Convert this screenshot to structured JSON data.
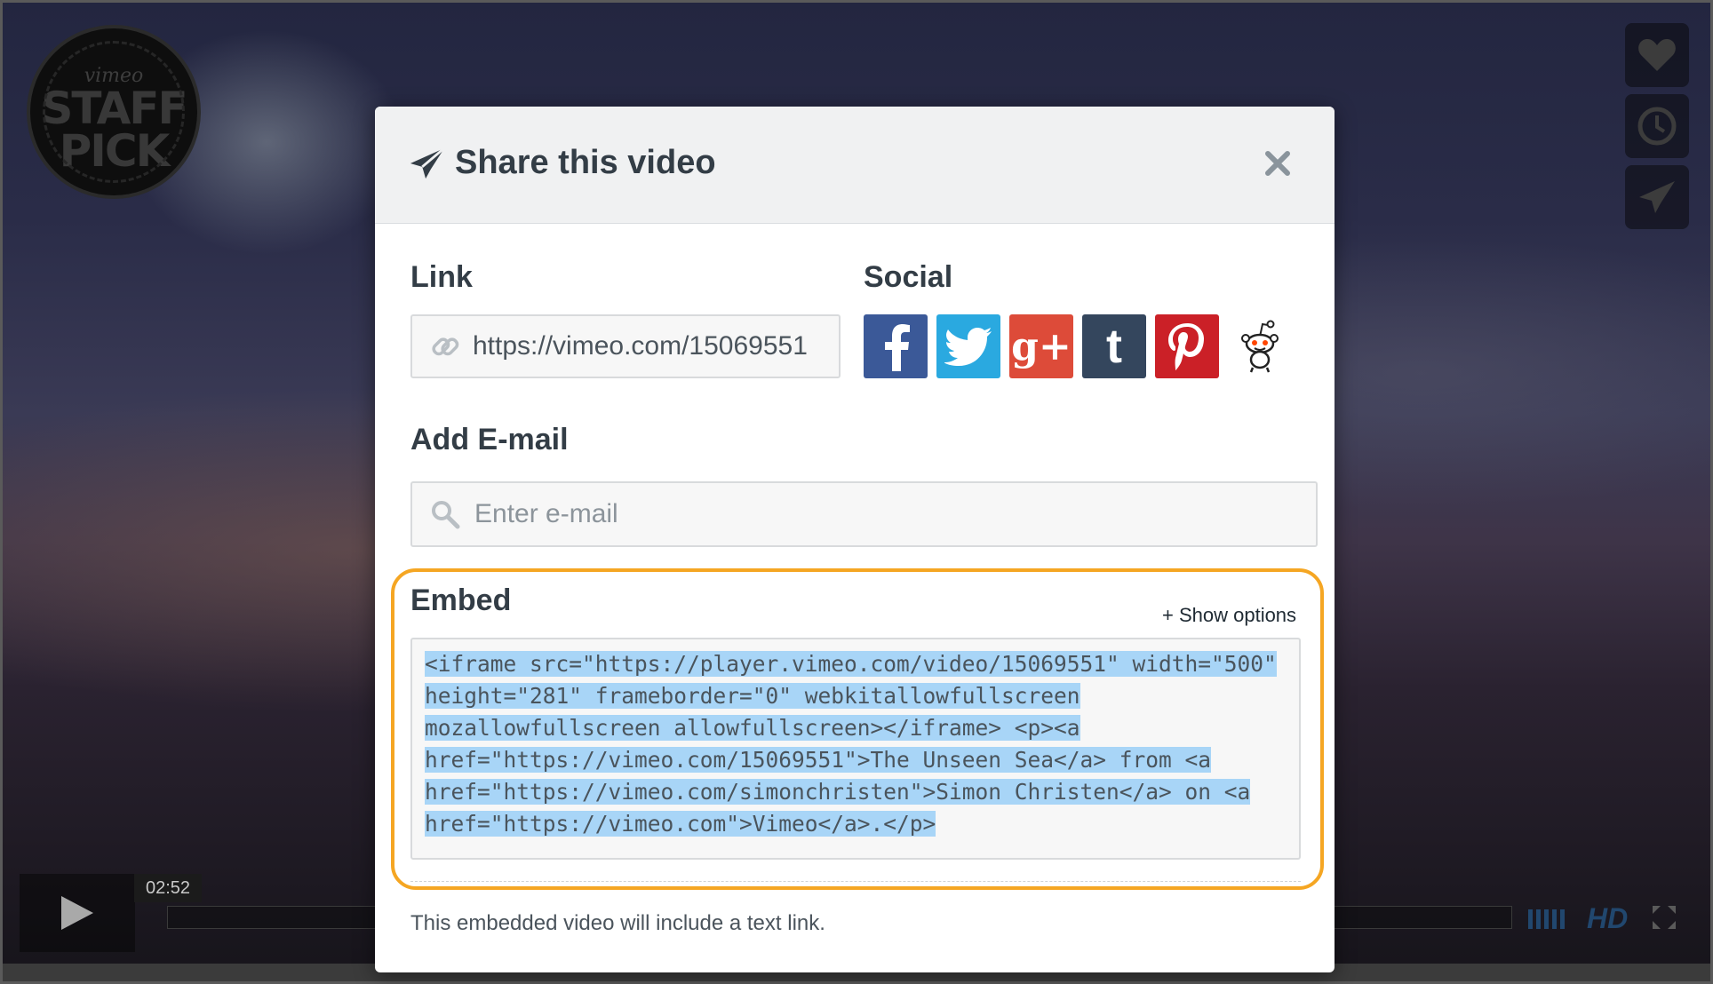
{
  "player": {
    "badge": {
      "line1": "vimeo",
      "line2": "STAFF",
      "line3": "PICK"
    },
    "side_buttons": [
      "heart-icon",
      "clock-icon",
      "send-icon"
    ],
    "time": "02:52",
    "hd_label": "HD"
  },
  "modal": {
    "title": "Share this video",
    "link": {
      "label": "Link",
      "value": "https://vimeo.com/15069551"
    },
    "social": {
      "label": "Social",
      "items": [
        {
          "name": "facebook",
          "glyph": "f",
          "color": "#3b5998"
        },
        {
          "name": "twitter",
          "glyph": "t",
          "color": "#2aa9e0"
        },
        {
          "name": "googleplus",
          "glyph": "g+",
          "color": "#dd4b39"
        },
        {
          "name": "tumblr",
          "glyph": "t",
          "color": "#34465d"
        },
        {
          "name": "pinterest",
          "glyph": "P",
          "color": "#cb2027"
        },
        {
          "name": "reddit",
          "glyph": "reddit",
          "color": "#ffffff"
        }
      ]
    },
    "email": {
      "label": "Add E-mail",
      "placeholder": "Enter e-mail"
    },
    "embed": {
      "label": "Embed",
      "show_options": "+ Show options",
      "code_lines": [
        "<iframe src=\"https://player.vimeo.com/video/15069551\" width=\"500\"",
        "height=\"281\" frameborder=\"0\" webkitallowfullscreen",
        "mozallowfullscreen allowfullscreen></iframe> <p><a",
        "href=\"https://vimeo.com/15069551\">The Unseen Sea</a> from <a",
        "href=\"https://vimeo.com/simonchristen\">Simon Christen</a> on <a",
        "href=\"https://vimeo.com\">Vimeo</a>.</p>"
      ],
      "note": "This embedded video will include a text link."
    },
    "colors": {
      "highlight": "#f5a623",
      "selection": "#a8d5f7",
      "title": "#333d46"
    }
  }
}
